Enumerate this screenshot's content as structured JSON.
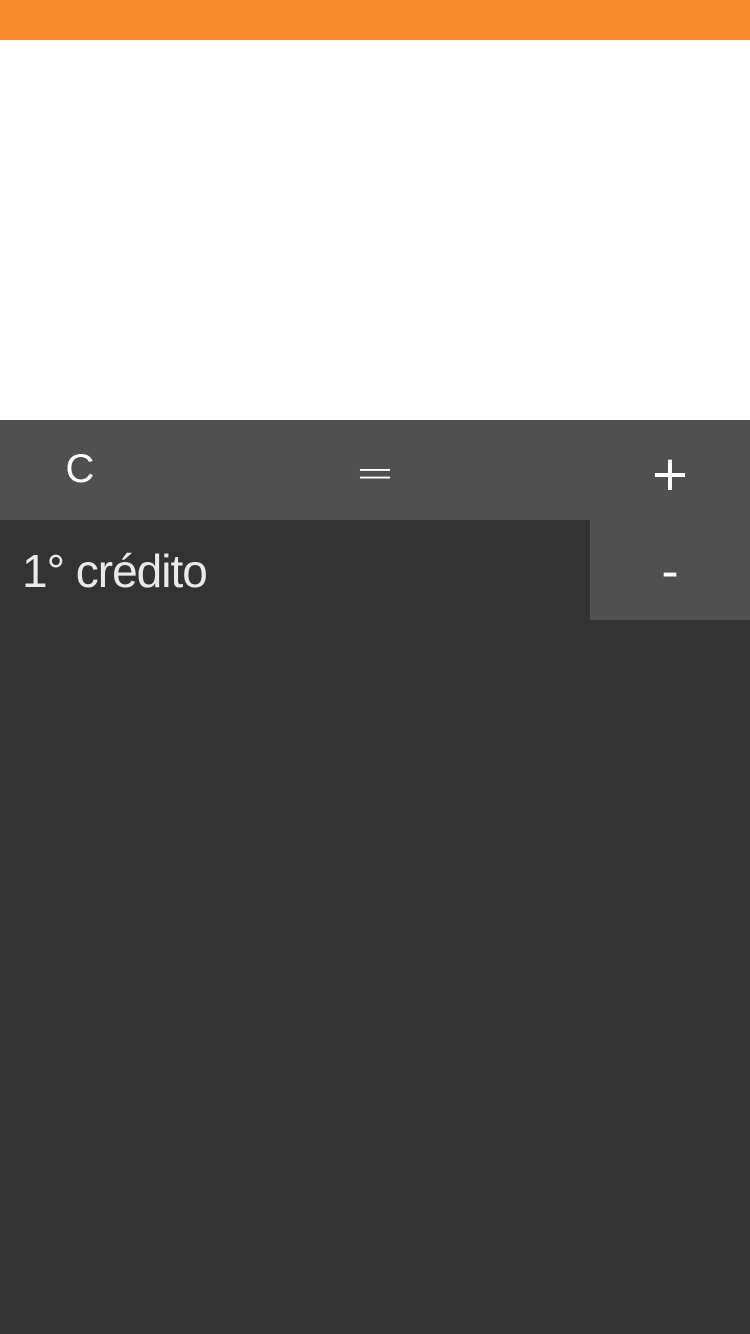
{
  "colors": {
    "status_bar": "#F68B2C",
    "display_background": "#FFFFFF",
    "toolbar_background": "#505050",
    "body_background": "#333333",
    "text_light": "#FFFFFF"
  },
  "toolbar": {
    "clear_label": "C",
    "equals_label": "=",
    "add_label": "+"
  },
  "entries": [
    {
      "label": "1° crédito",
      "remove_label": "-"
    }
  ]
}
